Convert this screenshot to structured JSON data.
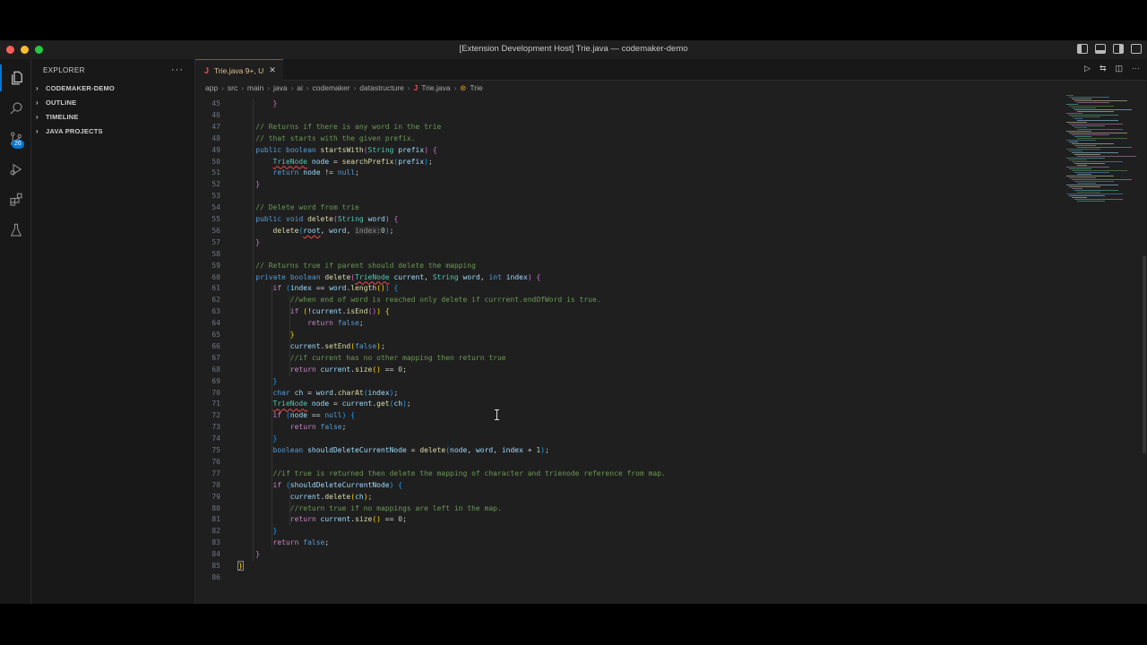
{
  "window": {
    "title": "[Extension Development Host] Trie.java — codemaker-demo"
  },
  "activity_bar": {
    "scm_badge": "26"
  },
  "sidebar": {
    "title": "EXPLORER",
    "more": "···",
    "sections": [
      {
        "label": "CODEMAKER-DEMO",
        "chevron": "›"
      },
      {
        "label": "OUTLINE",
        "chevron": "›"
      },
      {
        "label": "TIMELINE",
        "chevron": "›"
      },
      {
        "label": "JAVA PROJECTS",
        "chevron": "›"
      }
    ]
  },
  "tab": {
    "icon": "J",
    "label": "Trie.java",
    "status": "9+, U",
    "close": "✕"
  },
  "breadcrumb": {
    "items": [
      "app",
      "src",
      "main",
      "java",
      "ai",
      "codemaker",
      "datastructure"
    ],
    "file_icon": "J",
    "file": "Trie.java",
    "symbol": "Trie"
  },
  "code": {
    "lines": [
      {
        "n": "45",
        "html": "        <span class='p'>}</span>"
      },
      {
        "n": "46",
        "html": ""
      },
      {
        "n": "47",
        "html": "    <span class='c'>// Returns if there is any word in the trie</span>"
      },
      {
        "n": "48",
        "html": "    <span class='c'>// that starts with the given prefix.</span>"
      },
      {
        "n": "49",
        "html": "    <span class='k'>public</span> <span class='k'>boolean</span> <span class='f'>startsWith</span><span class='p'>(</span><span class='t'>String</span> <span class='v'>prefix</span><span class='p'>)</span> <span class='p'>{</span>"
      },
      {
        "n": "50",
        "html": "        <span class='t sq'>TrieNode</span> <span class='v'>node</span> = <span class='f'>searchPrefix</span><span class='p2'>(</span><span class='v'>prefix</span><span class='p2'>)</span>;"
      },
      {
        "n": "51",
        "html": "        <span class='k'>return</span> <span class='v'>node</span> != <span class='k'>null</span>;"
      },
      {
        "n": "52",
        "html": "    <span class='p'>}</span>"
      },
      {
        "n": "53",
        "html": ""
      },
      {
        "n": "54",
        "html": "    <span class='c'>// Delete word from trie</span>"
      },
      {
        "n": "55",
        "html": "    <span class='k'>public</span> <span class='k'>void</span> <span class='f'>delete</span><span class='p'>(</span><span class='t'>String</span> <span class='v'>word</span><span class='p'>)</span> <span class='p'>{</span>"
      },
      {
        "n": "56",
        "html": "        <span class='f'>delete</span><span class='p2'>(</span><span class='v sq'>root</span>, <span class='v'>word</span>, <span class='hint'>index:</span><span class='n'>0</span><span class='p2'>)</span>;"
      },
      {
        "n": "57",
        "html": "    <span class='p'>}</span>"
      },
      {
        "n": "58",
        "html": ""
      },
      {
        "n": "59",
        "html": "    <span class='c'>// Returns true if parent should delete the mapping</span>"
      },
      {
        "n": "60",
        "html": "    <span class='k'>private</span> <span class='k'>boolean</span> <span class='f'>delete</span><span class='p'>(</span><span class='t sq'>TrieNode</span> <span class='v'>current</span>, <span class='t'>String</span> <span class='v'>word</span>, <span class='k'>int</span> <span class='v'>index</span><span class='p'>)</span> <span class='p'>{</span>"
      },
      {
        "n": "61",
        "html": "        <span class='kc'>if</span> <span class='p2'>(</span><span class='v'>index</span> == <span class='v'>word</span>.<span class='f'>length</span><span class='p3'>()</span><span class='p2'>)</span> <span class='p2'>{</span>"
      },
      {
        "n": "62",
        "html": "            <span class='c'>//when end of word is reached only delete if currrent.endOfWord is true.</span>"
      },
      {
        "n": "63",
        "html": "            <span class='kc'>if</span> <span class='p3'>(</span>!<span class='v'>current</span>.<span class='f'>isEnd</span><span class='p'>()</span><span class='p3'>)</span> <span class='p3'>{</span>"
      },
      {
        "n": "64",
        "html": "                <span class='kc'>return</span> <span class='k'>false</span>;"
      },
      {
        "n": "65",
        "html": "            <span class='p3'>}</span>"
      },
      {
        "n": "66",
        "html": "            <span class='v'>current</span>.<span class='f'>setEnd</span><span class='p3'>(</span><span class='k'>false</span><span class='p3'>)</span>;"
      },
      {
        "n": "67",
        "html": "            <span class='c'>//if current has no other mapping then return true</span>"
      },
      {
        "n": "68",
        "html": "            <span class='kc'>return</span> <span class='v'>current</span>.<span class='f'>size</span><span class='p3'>()</span> == <span class='n'>0</span>;"
      },
      {
        "n": "69",
        "html": "        <span class='p2'>}</span>"
      },
      {
        "n": "70",
        "html": "        <span class='k'>char</span> <span class='v'>ch</span> = <span class='v'>word</span>.<span class='f'>charAt</span><span class='p2'>(</span><span class='v'>index</span><span class='p2'>)</span>;"
      },
      {
        "n": "71",
        "html": "        <span class='t sq'>TrieNode</span> <span class='v'>node</span> = <span class='v'>current</span>.<span class='f'>get</span><span class='p2'>(</span><span class='v'>ch</span><span class='p2'>)</span>;"
      },
      {
        "n": "72",
        "html": "        <span class='kc'>if</span> <span class='p2'>(</span><span class='v'>node</span> == <span class='k'>null</span><span class='p2'>)</span> <span class='p2'>{</span>"
      },
      {
        "n": "73",
        "html": "            <span class='kc'>return</span> <span class='k'>false</span>;"
      },
      {
        "n": "74",
        "html": "        <span class='p2'>}</span>"
      },
      {
        "n": "75",
        "html": "        <span class='k'>boolean</span> <span class='v'>shouldDeleteCurrentNode</span> = <span class='f'>delete</span><span class='p2'>(</span><span class='v'>node</span>, <span class='v'>word</span>, <span class='v'>index</span> + <span class='n'>1</span><span class='p2'>)</span>;"
      },
      {
        "n": "76",
        "html": ""
      },
      {
        "n": "77",
        "html": "        <span class='c'>//if true is returned then delete the mapping of character and trienode reference from map.</span>"
      },
      {
        "n": "78",
        "html": "        <span class='kc'>if</span> <span class='p2'>(</span><span class='v'>shouldDeleteCurrentNode</span><span class='p2'>)</span> <span class='p2'>{</span>"
      },
      {
        "n": "79",
        "html": "            <span class='v'>current</span>.<span class='f'>delete</span><span class='p3'>(</span><span class='v'>ch</span><span class='p3'>)</span>;"
      },
      {
        "n": "80",
        "html": "            <span class='c'>//return true if no mappings are left in the map.</span>"
      },
      {
        "n": "81",
        "html": "            <span class='kc'>return</span> <span class='v'>current</span>.<span class='f'>size</span><span class='p3'>()</span> == <span class='n'>0</span>;"
      },
      {
        "n": "82",
        "html": "        <span class='p2'>}</span>"
      },
      {
        "n": "83",
        "html": "        <span class='kc'>return</span> <span class='k'>false</span>;"
      },
      {
        "n": "84",
        "html": "    <span class='p'>}</span>"
      },
      {
        "n": "85",
        "html": "<span class='brk'>}</span>"
      },
      {
        "n": "86",
        "html": ""
      }
    ]
  },
  "colors": {
    "keyword": "#569cd6",
    "control": "#c586c0",
    "type": "#4ec9b0",
    "function": "#dcdcaa",
    "variable": "#9cdcfe",
    "comment": "#6a9955",
    "number": "#b5cea8",
    "accent": "#0078d4"
  }
}
